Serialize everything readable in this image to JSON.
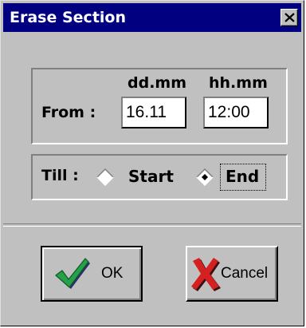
{
  "dialog": {
    "title": "Erase Section",
    "close_icon": "close-x-icon"
  },
  "from": {
    "label": "From :",
    "col_date_header": "dd.mm",
    "col_time_header": "hh.mm",
    "date_value": "16.11",
    "time_value": "12:00"
  },
  "till": {
    "label": "Till :",
    "options": [
      {
        "label": "Start",
        "selected": false
      },
      {
        "label": "End",
        "selected": true
      }
    ]
  },
  "buttons": {
    "ok": {
      "label": "OK",
      "icon": "checkmark-icon",
      "color": "#1f8f3a"
    },
    "cancel": {
      "label": "Cancel",
      "icon": "red-x-icon",
      "color": "#cc1111"
    }
  },
  "colors": {
    "title_bar": "#000080",
    "face": "#c0c0c0"
  }
}
